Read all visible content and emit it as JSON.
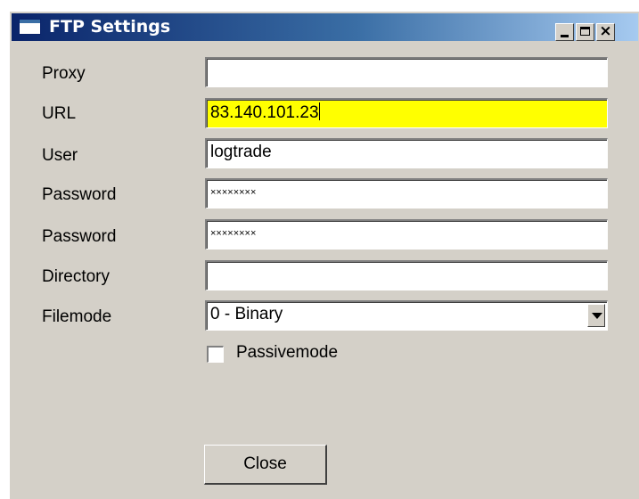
{
  "window": {
    "title": "FTP Settings",
    "close_glyph": "×"
  },
  "form": {
    "proxy": {
      "label": "Proxy",
      "value": ""
    },
    "url": {
      "label": "URL",
      "value": "83.140.101.23"
    },
    "user": {
      "label": "User",
      "value": "logtrade"
    },
    "password1": {
      "label": "Password",
      "value": "××××××××"
    },
    "password2": {
      "label": "Password",
      "value": "××××××××"
    },
    "directory": {
      "label": "Directory",
      "value": ""
    },
    "filemode": {
      "label": "Filemode",
      "value": "0 - Binary"
    },
    "passivemode": {
      "label": "Passivemode",
      "checked": false
    }
  },
  "buttons": {
    "close_label": "Close"
  },
  "colors": {
    "highlight_field": "#ffff00",
    "dialog_bg": "#d4d0c8"
  },
  "icons": [
    "window-app-icon",
    "minimize-icon",
    "maximize-icon",
    "close-icon",
    "chevron-down-icon"
  ]
}
